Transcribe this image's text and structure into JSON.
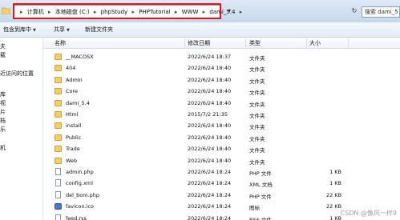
{
  "address_bar": {
    "crumbs": [
      "计算机",
      "本地磁盘 (C:)",
      "phpStudy",
      "PHPTutorial",
      "WWW",
      "dami_5.4"
    ],
    "search_label": "搜索 dami_5"
  },
  "toolbar": {
    "include_label": "包含到库中",
    "share_label": "共享",
    "new_folder_label": "新建文件夹"
  },
  "sidebar": {
    "items": [
      "夫",
      "载",
      "近访问的位置",
      "库",
      "视",
      "片",
      "档",
      "乐",
      "机"
    ]
  },
  "columns": {
    "name": "名称",
    "date": "修改日期",
    "type": "类型",
    "size": "大小"
  },
  "files": [
    {
      "name": "__MACOSX",
      "date": "2022/6/24 18:37",
      "type": "文件夹",
      "size": "",
      "icon": "folder-icon"
    },
    {
      "name": "404",
      "date": "2022/6/24 18:40",
      "type": "文件夹",
      "size": "",
      "icon": "folder-icon"
    },
    {
      "name": "Admin",
      "date": "2022/6/24 18:40",
      "type": "文件夹",
      "size": "",
      "icon": "folder-icon"
    },
    {
      "name": "Core",
      "date": "2022/6/24 18:40",
      "type": "文件夹",
      "size": "",
      "icon": "folder-icon"
    },
    {
      "name": "dami_5.4",
      "date": "2022/6/24 18:40",
      "type": "文件夹",
      "size": "",
      "icon": "folder-icon"
    },
    {
      "name": "Html",
      "date": "2015/7/2 21:35",
      "type": "文件夹",
      "size": "",
      "icon": "folder-icon"
    },
    {
      "name": "install",
      "date": "2022/6/24 18:40",
      "type": "文件夹",
      "size": "",
      "icon": "folder-icon"
    },
    {
      "name": "Public",
      "date": "2022/6/24 18:40",
      "type": "文件夹",
      "size": "",
      "icon": "folder-icon"
    },
    {
      "name": "Trade",
      "date": "2022/6/24 18:40",
      "type": "文件夹",
      "size": "",
      "icon": "folder-icon"
    },
    {
      "name": "Web",
      "date": "2022/6/24 18:40",
      "type": "文件夹",
      "size": "",
      "icon": "folder-icon"
    },
    {
      "name": "admin.php",
      "date": "2022/6/24 18:24",
      "type": "PHP 文件",
      "size": "1 KB",
      "icon": "php-file-icon"
    },
    {
      "name": "config.xml",
      "date": "2022/6/24 18:24",
      "type": "XML 文档",
      "size": "1 KB",
      "icon": "xml-file-icon"
    },
    {
      "name": "del_bom.php",
      "date": "2022/6/24 18:24",
      "type": "PHP 文件",
      "size": "22 KB",
      "icon": "php-file-icon"
    },
    {
      "name": "favicon.ico",
      "date": "2022/6/24 18:24",
      "type": "图标",
      "size": "22 KB",
      "icon": "favicon-icon"
    },
    {
      "name": "feed.rss",
      "date": "2022/6/24 18:24",
      "type": "RSS 文件",
      "size": "1 KB",
      "icon": "rss-file-icon"
    }
  ],
  "watermark": "CSDN @像风一样9"
}
